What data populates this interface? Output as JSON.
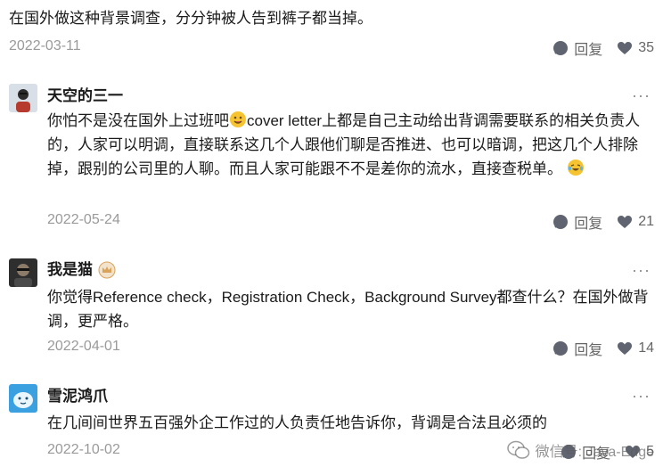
{
  "top_comment": {
    "text": "在国外做这种背景调查，分分钟被人告到裤子都当掉。",
    "date": "2022-03-11",
    "reply_label": "回复",
    "likes": "35"
  },
  "comments": [
    {
      "name": "天空的三一",
      "text_1": "你怕不是没在国外上过班吧",
      "text_2": "cover letter上都是自己主动给出背调需要联系的相关负责人的，人家可以明调，直接联系这几个人跟他们聊是否推进、也可以暗调，把这几个人排除掉，跟别的公司里的人聊。而且人家可能跟不不是差你的流水，直接查税单。",
      "date": "2022-05-24",
      "reply_label": "回复",
      "likes": "21"
    },
    {
      "name": "我是猫",
      "text": "你觉得Reference check，Registration Check，Background Survey都查什么？在国外做背调，更严格。",
      "date": "2022-04-01",
      "reply_label": "回复",
      "likes": "14"
    },
    {
      "name": "雪泥鸿爪",
      "text": "在几间间世界五百强外企工作过的人负责任地告诉你，背调是合法且必须的",
      "date": "2022-10-02",
      "reply_label": "回复",
      "likes": "5"
    }
  ],
  "more_label": "···",
  "watermark": "微信号: Java-Edge",
  "colors": {
    "muted": "#9a9a9a",
    "icon": "#5f6470",
    "badge": "#d9a35b"
  }
}
